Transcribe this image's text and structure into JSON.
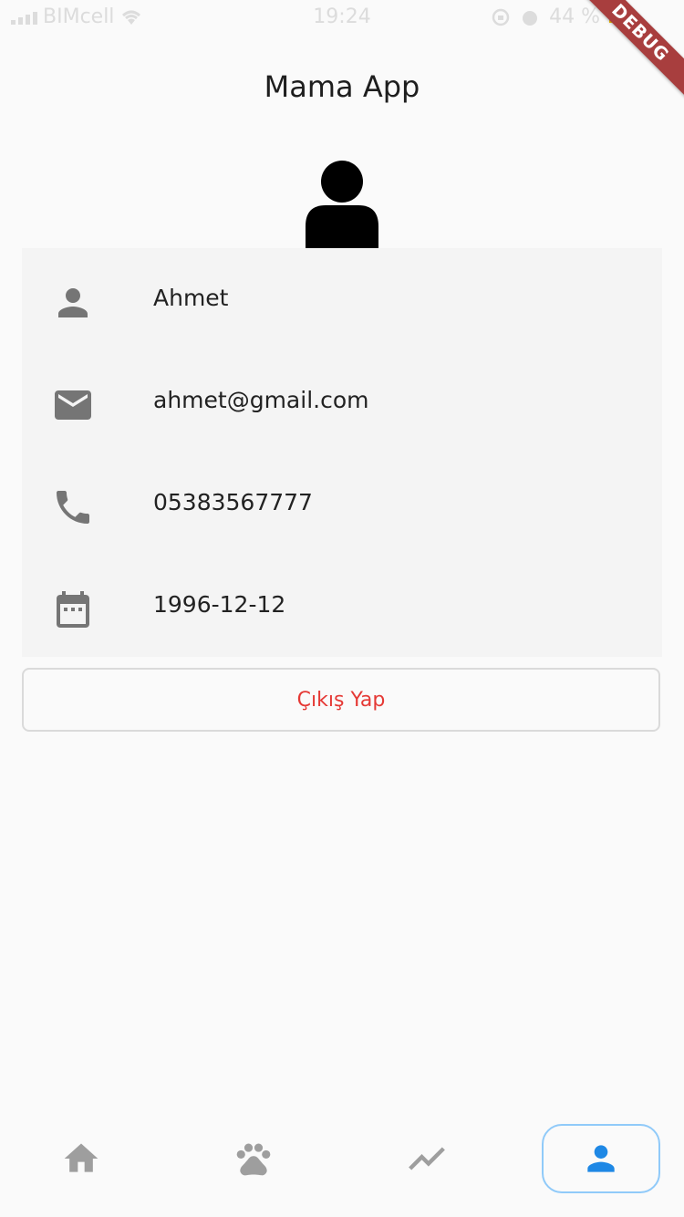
{
  "status_bar": {
    "carrier": "BIMcell",
    "time": "19:24",
    "battery": "44 %"
  },
  "debug_banner": "DEBUG",
  "app_title": "Mama App",
  "profile": {
    "name": "Ahmet",
    "email": "ahmet@gmail.com",
    "phone": "05383567777",
    "birth_date": "1996-12-12"
  },
  "logout_label": "Çıkış Yap",
  "colors": {
    "background": "#fafafa",
    "card": "#f4f4f4",
    "icon_gray": "#757575",
    "logout_red": "#e53935",
    "active_blue": "#1e88e5"
  },
  "bottom_nav": {
    "items": [
      {
        "icon": "home-icon",
        "active": false
      },
      {
        "icon": "paw-icon",
        "active": false
      },
      {
        "icon": "trending-icon",
        "active": false
      },
      {
        "icon": "person-icon",
        "active": true
      }
    ]
  }
}
